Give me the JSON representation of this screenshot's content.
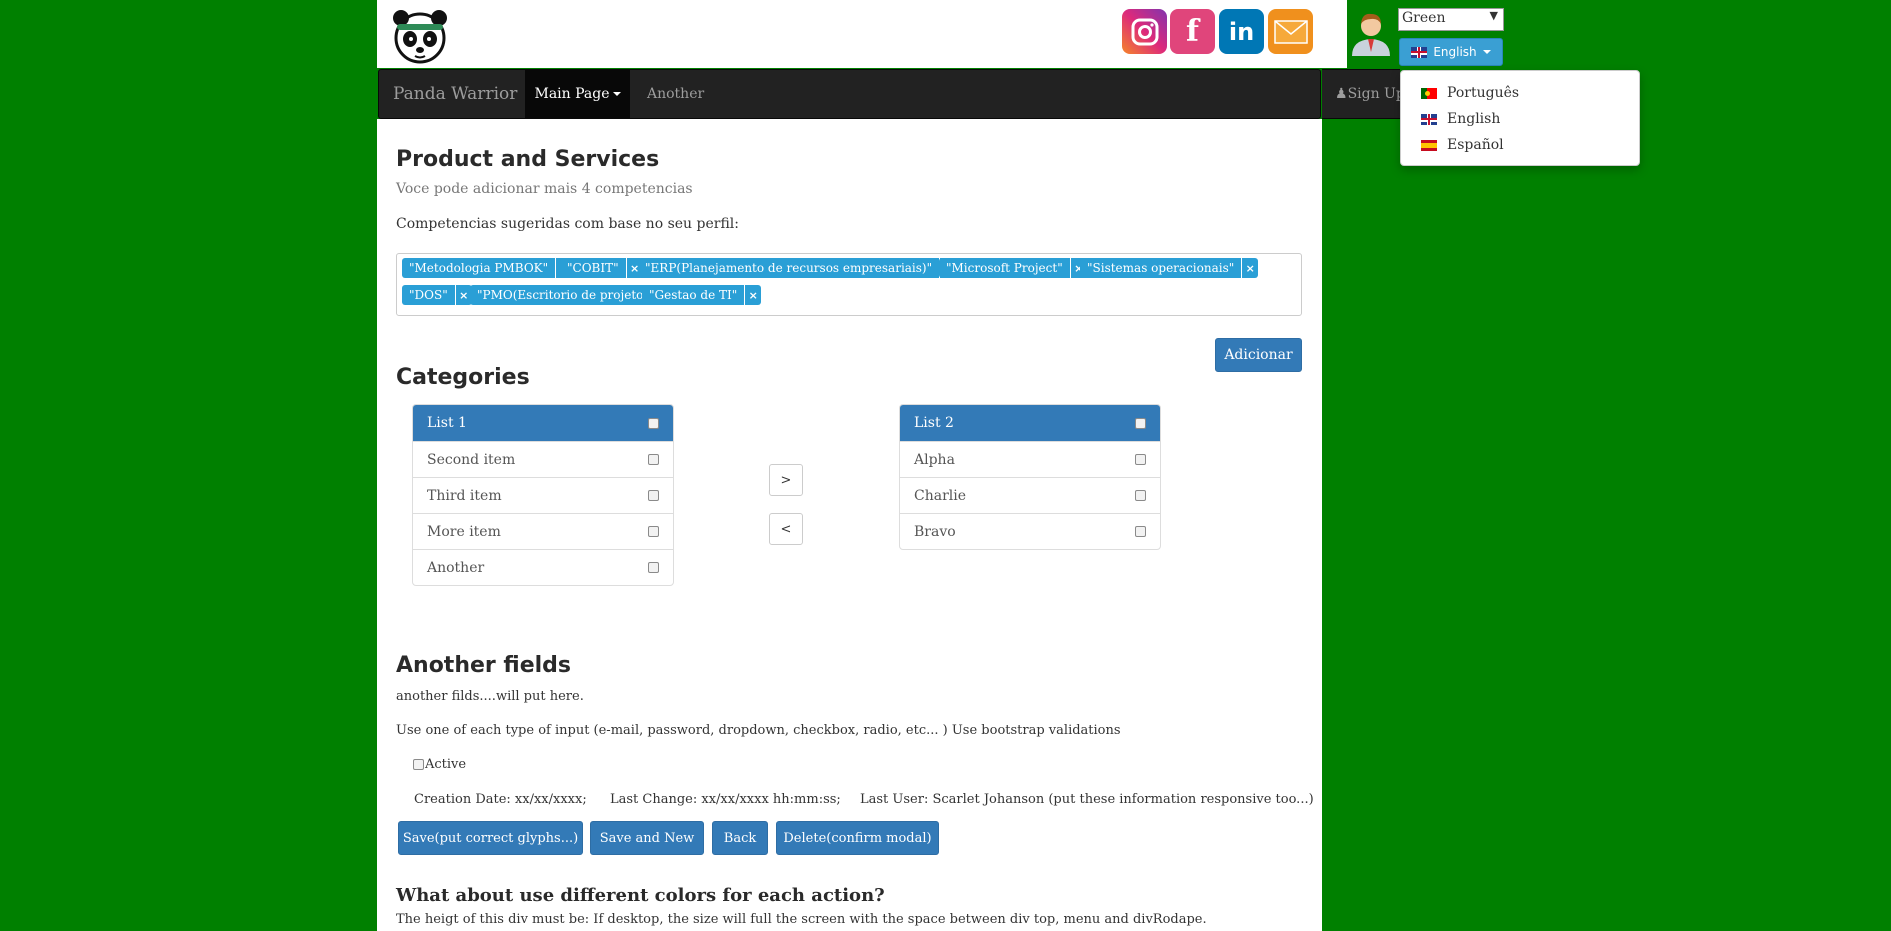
{
  "header": {
    "theme_select": {
      "value": "Green",
      "arrow": "▼"
    },
    "language_button": {
      "label": "English",
      "flag": "flag-uk"
    },
    "social": [
      {
        "name": "instagram-icon",
        "colors": [
          "#f58529",
          "#dd2a7b",
          "#8134af"
        ]
      },
      {
        "name": "facebook-icon",
        "label": "f",
        "color": "#e0457b"
      },
      {
        "name": "linkedin-icon",
        "label": "in",
        "color": "#0077b5"
      },
      {
        "name": "email-icon",
        "color": "#f0901d"
      }
    ]
  },
  "language_menu": {
    "items": [
      {
        "label": "Português",
        "flag": "flag-pt"
      },
      {
        "label": "English",
        "flag": "flag-uk"
      },
      {
        "label": "Español",
        "flag": "flag-es"
      }
    ]
  },
  "navbar": {
    "brand": "Panda Warrior",
    "items": [
      {
        "label": "Main Page"
      },
      {
        "label": "Another"
      }
    ],
    "sign_up": "Sign Up"
  },
  "products": {
    "title": "Product and Services",
    "subtitle": "Voce pode adicionar mais 4 competencias",
    "suggest_label": "Competencias sugeridas com base no seu perfil:",
    "tags": [
      "\"Metodologia PMBOK\"",
      "\"COBIT\"",
      "\"ERP(Planejamento de recursos empresariais)\"",
      "\"Microsoft Project\"",
      "\"Sistemas operacionais\"",
      "\"DOS\"",
      "\"PMO(Escritorio de projetos)\"",
      "\"Gestao de TI\""
    ],
    "tag_remove": "×",
    "add_button": "Adicionar"
  },
  "categories": {
    "title": "Categories",
    "list1": {
      "title": "List 1",
      "items": [
        "Second item",
        "Third item",
        "More item",
        "Another"
      ]
    },
    "list2": {
      "title": "List 2",
      "items": [
        "Alpha",
        "Charlie",
        "Bravo"
      ]
    },
    "move_right": ">",
    "move_left": "<"
  },
  "another": {
    "title": "Another fields",
    "line1": "another filds....will put here.",
    "line2": "Use one of each type of input (e-mail, password, dropdown, checkbox, radio, etc... ) Use bootstrap validations",
    "active_label": "Active",
    "creation": "Creation Date: xx/xx/xxxx;",
    "last_change": "Last Change: xx/xx/xxxx hh:mm:ss;",
    "last_user": "Last User: Scarlet Johanson (put these information responsive too...)",
    "buttons": [
      "Save(put correct glyphs...)",
      "Save and New",
      "Back",
      "Delete(confirm modal)"
    ]
  },
  "footer_section": {
    "title": "What about use different colors for each action?",
    "text": "The heigt of this div must be: If desktop, the size will full the screen with the space between div top, menu and divRodape."
  },
  "colors": {
    "background": "#008000",
    "primary": "#337ab7",
    "tag": "#2a9fd6",
    "navbar": "#222222"
  }
}
